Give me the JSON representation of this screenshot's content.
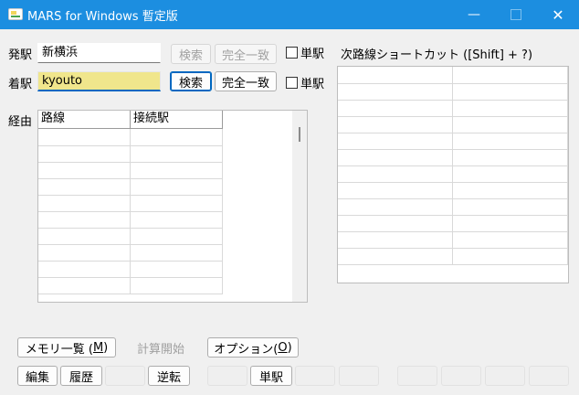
{
  "window": {
    "title": "MARS for Windows 暫定版",
    "minimize_glyph": "—",
    "close_glyph": "✕"
  },
  "departure": {
    "label": "発駅",
    "value": "新横浜",
    "search_label": "検索",
    "exact_label": "完全一致",
    "single_label": "単駅"
  },
  "arrival": {
    "label": "着駅",
    "value": "kyouto",
    "search_label": "検索",
    "exact_label": "完全一致",
    "single_label": "単駅"
  },
  "route": {
    "label": "経由",
    "columns": [
      "路線",
      "接続駅"
    ],
    "rows": [
      [
        "",
        ""
      ],
      [
        "",
        ""
      ],
      [
        "",
        ""
      ],
      [
        "",
        ""
      ],
      [
        "",
        ""
      ],
      [
        "",
        ""
      ],
      [
        "",
        ""
      ],
      [
        "",
        ""
      ],
      [
        "",
        ""
      ],
      [
        "",
        ""
      ]
    ]
  },
  "shortcut": {
    "label": "次路線ショートカット ([Shift] + ?)",
    "rows": [
      [
        "",
        ""
      ],
      [
        "",
        ""
      ],
      [
        "",
        ""
      ],
      [
        "",
        ""
      ],
      [
        "",
        ""
      ],
      [
        "",
        ""
      ],
      [
        "",
        ""
      ],
      [
        "",
        ""
      ],
      [
        "",
        ""
      ],
      [
        "",
        ""
      ],
      [
        "",
        ""
      ],
      [
        "",
        ""
      ]
    ]
  },
  "buttons": {
    "memory_list": "メモリ一覧 (",
    "memory_key": "M",
    "memory_end": ")",
    "calc_start": "計算開始",
    "options": "オプション(",
    "options_key": "O",
    "options_end": ")",
    "edit": "編集",
    "history": "履歴",
    "reverse": "逆転",
    "single": "単駅"
  },
  "colors": {
    "titlebar": "#1c8ee0",
    "active_field": "#f0e68c",
    "focus_border": "#0067c0"
  }
}
